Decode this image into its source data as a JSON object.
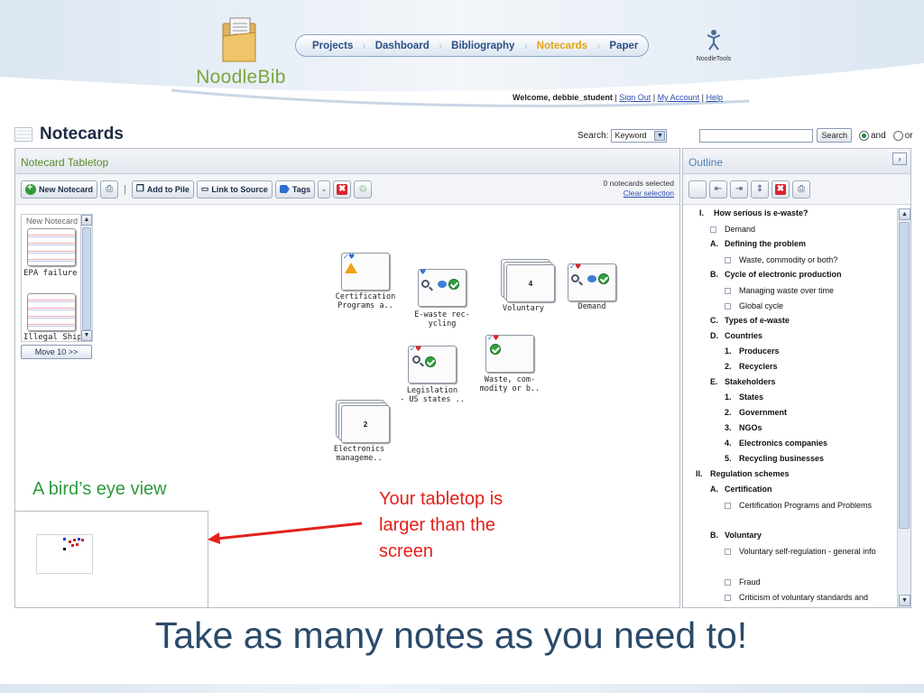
{
  "header": {
    "brand": "NoodleBib",
    "nav": [
      {
        "label": "Projects",
        "active": false
      },
      {
        "label": "Dashboard",
        "active": false
      },
      {
        "label": "Bibliography",
        "active": false
      },
      {
        "label": "Notecards",
        "active": true
      },
      {
        "label": "Paper",
        "active": false
      }
    ],
    "partner_logo_text": "NoodleTools",
    "welcome_prefix": "Welcome, debbie_student",
    "sign_out": "Sign Out",
    "my_account": "My Account",
    "help": "Help"
  },
  "page": {
    "title": "Notecards",
    "search_label": "Search:",
    "search_scope": "Keyword",
    "search_value": "",
    "search_button": "Search",
    "radio_and": "and",
    "radio_or": "or"
  },
  "tabletop": {
    "panel_title": "Notecard Tabletop",
    "toolbar": {
      "new_notecard": "New Notecard",
      "add_to_pile": "Add to Pile",
      "link_to_source": "Link to Source",
      "tags": "Tags"
    },
    "selection_count": "0 notecards selected",
    "clear_selection": "Clear selection",
    "strip_label": "New Notecard",
    "strip_cards": [
      "EPA failure",
      "Illegal Ship-"
    ],
    "move_button": "Move 10 >>",
    "cards": [
      {
        "label": "Certification\nPrograms a.."
      },
      {
        "label": "E-waste rec-\nycling"
      },
      {
        "label": "Voluntary",
        "count": "4"
      },
      {
        "label": "Demand"
      },
      {
        "label": "Legislation\n- US states .."
      },
      {
        "label": "Waste, com-\nmodity or b.."
      },
      {
        "label": "Electronics\nmanageme..",
        "count": "2"
      }
    ]
  },
  "outline": {
    "panel_title": "Outline",
    "items": [
      {
        "marker": "I.",
        "text": "How serious is e-waste?",
        "bold": true
      },
      {
        "marker": "",
        "text": "Demand",
        "bold": false,
        "note": true
      },
      {
        "marker": "A.",
        "text": "Defining the problem",
        "bold": true
      },
      {
        "marker": "",
        "text": "Waste, commodity or both?",
        "bold": false,
        "note": true
      },
      {
        "marker": "B.",
        "text": "Cycle of electronic production",
        "bold": true
      },
      {
        "marker": "",
        "text": "Managing waste over time",
        "bold": false,
        "note": true
      },
      {
        "marker": "",
        "text": "Global cycle",
        "bold": false,
        "note": true
      },
      {
        "marker": "C.",
        "text": "Types of e-waste",
        "bold": true
      },
      {
        "marker": "D.",
        "text": "Countries",
        "bold": true
      },
      {
        "marker": "1.",
        "text": "Producers",
        "bold": true
      },
      {
        "marker": "2.",
        "text": "Recyclers",
        "bold": true
      },
      {
        "marker": "E.",
        "text": "Stakeholders",
        "bold": true
      },
      {
        "marker": "1.",
        "text": "States",
        "bold": true
      },
      {
        "marker": "2.",
        "text": "Government",
        "bold": true
      },
      {
        "marker": "3.",
        "text": "NGOs",
        "bold": true
      },
      {
        "marker": "4.",
        "text": "Electronics companies",
        "bold": true
      },
      {
        "marker": "5.",
        "text": "Recycling businesses",
        "bold": true
      },
      {
        "marker": "II.",
        "text": "Regulation schemes",
        "bold": true
      },
      {
        "marker": "A.",
        "text": "Certification",
        "bold": true
      },
      {
        "marker": "",
        "text": "Certification Programs and Problems",
        "bold": false,
        "note": true
      },
      {
        "marker": "B.",
        "text": "Voluntary",
        "bold": true
      },
      {
        "marker": "",
        "text": "Voluntary self-regulation - general info",
        "bold": false,
        "note": true
      },
      {
        "marker": "",
        "text": "Fraud",
        "bold": false,
        "note": true
      },
      {
        "marker": "",
        "text": "Criticism of voluntary standards and",
        "bold": false,
        "note": true
      }
    ]
  },
  "slide": {
    "birds_eye_label": "A bird’s eye view",
    "annotation": "Your tabletop is\nlarger than the\nscreen",
    "bottom_title": "Take as many notes as you need to!"
  },
  "colors": {
    "accent_green": "#2d9b3e",
    "annotation_red": "#e3201b",
    "nav_active": "#e4a312",
    "title_blue": "#2a4a69"
  }
}
